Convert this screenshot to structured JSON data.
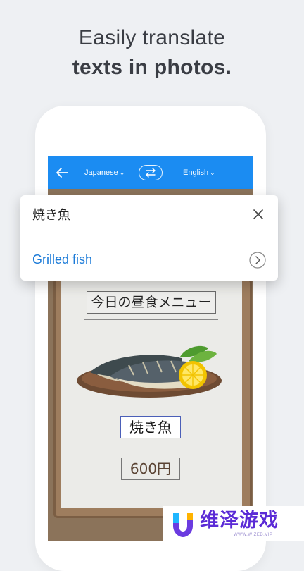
{
  "headline": {
    "line1": "Easily translate",
    "line2": "texts in photos."
  },
  "app_bar": {
    "back_icon": "arrow-left-icon",
    "source_language": "Japanese",
    "target_language": "English",
    "swap_icon": "swap-arrows-icon",
    "color": "#1b8cf2"
  },
  "photo": {
    "menu_title": "今日の昼食メニュー",
    "dish_name": "焼き魚",
    "price": "600円"
  },
  "translation_card": {
    "source_text": "焼き魚",
    "translated_text": "Grilled fish",
    "close_icon": "close-icon",
    "open_icon": "chevron-right-circle-icon",
    "link_color": "#1c7bd8"
  },
  "watermark": {
    "text": "维泽游戏",
    "url": "WWW.WIZED.VIP",
    "color": "#5b2bd6"
  }
}
